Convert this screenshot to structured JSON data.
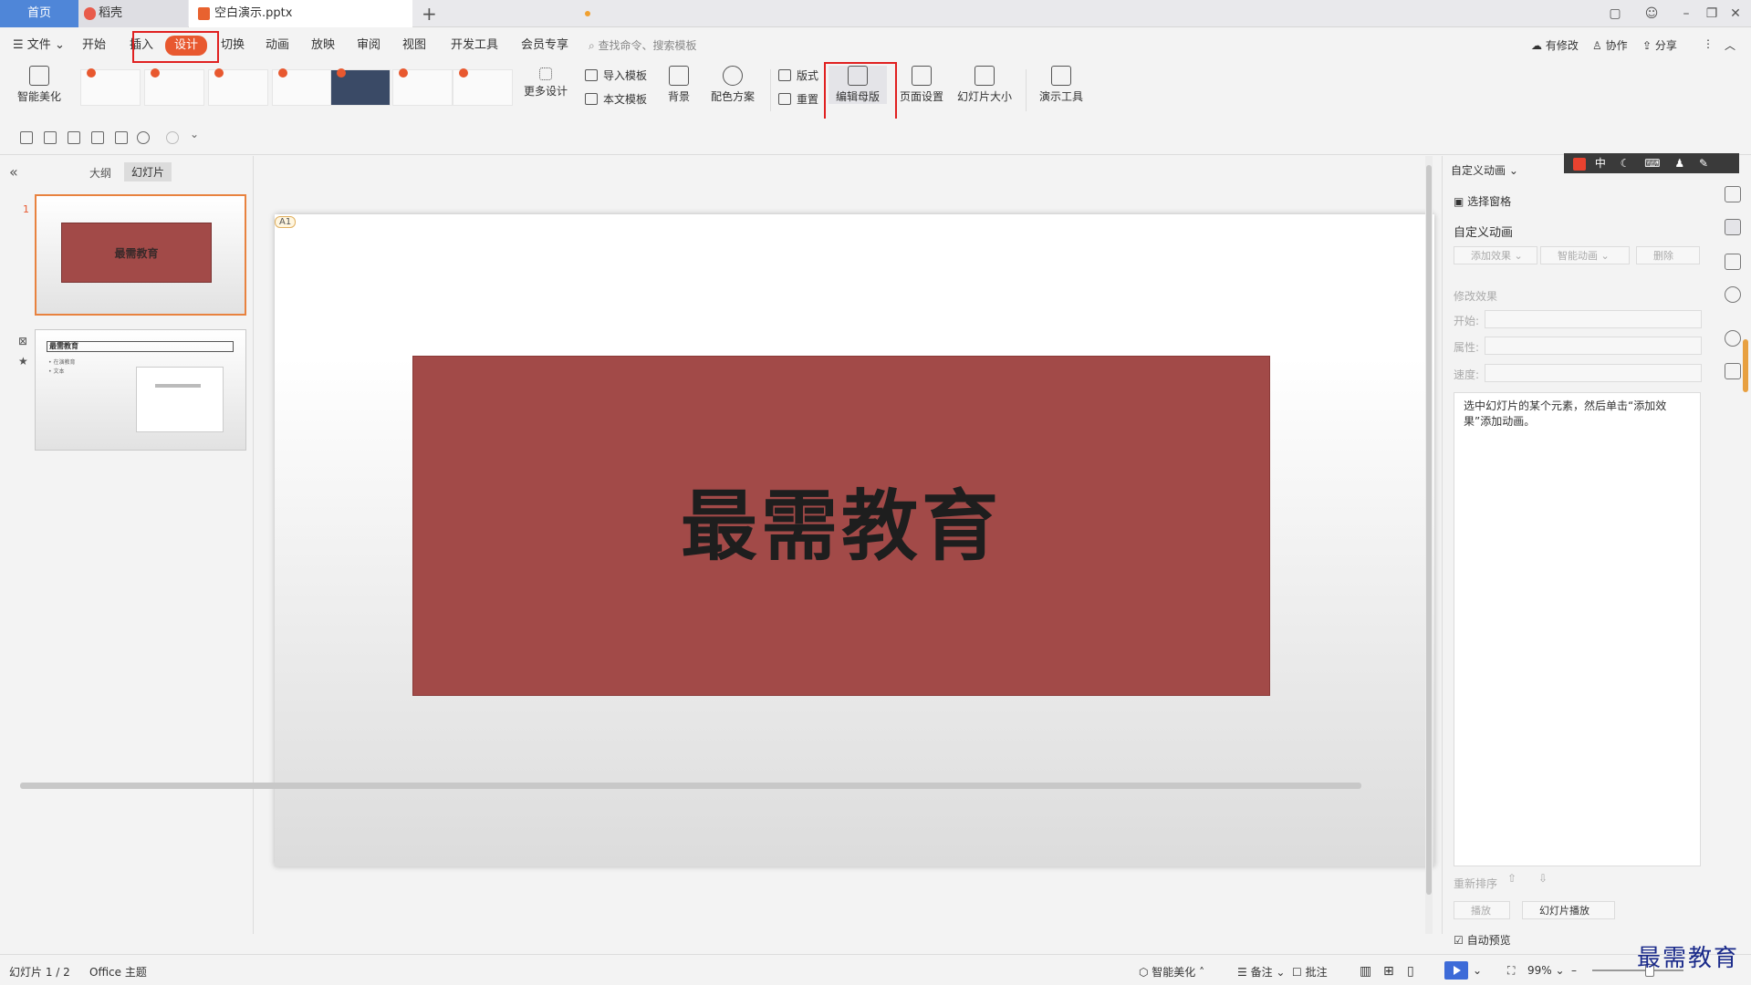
{
  "tabs": {
    "home": "首页",
    "docer": "稻壳",
    "file": "空白演示.pptx",
    "new_tab": "+"
  },
  "menu": {
    "file": "文件",
    "items": [
      "开始",
      "插入",
      "设计",
      "切换",
      "动画",
      "放映",
      "审阅",
      "视图",
      "开发工具",
      "会员专享"
    ],
    "search_placeholder": "查找命令、搜索模板",
    "right": [
      "有修改",
      "协作",
      "分享"
    ]
  },
  "ribbon": {
    "smart_beautify": "智能美化",
    "more_design": "更多设计",
    "import_template": "导入模板",
    "text_template": "本文模板",
    "background": "背景",
    "color_scheme": "配色方案",
    "layout": "版式",
    "reset": "重置",
    "edit_master": "编辑母版",
    "page_setup": "页面设置",
    "slide_size": "幻灯片大小",
    "presentation_tools": "演示工具"
  },
  "left_panel": {
    "outline": "大纲",
    "slides": "幻灯片",
    "slide1_num": "1",
    "slide1_text": "最需教育",
    "slide2_title": "最需教育",
    "slide2_bullets": [
      "• 在演教育",
      "• 文本"
    ]
  },
  "canvas": {
    "tag": "A1",
    "title": "最需教育"
  },
  "right_panel": {
    "header": "自定义动画",
    "selection_pane": "选择窗格",
    "section": "自定义动画",
    "add_effect": "添加效果",
    "smart_anim": "智能动画",
    "delete": "删除",
    "modify": "修改效果",
    "start": "开始:",
    "property": "属性:",
    "speed": "速度:",
    "info": "选中幻灯片的某个元素，然后单击“添加效果”添加动画。",
    "reorder": "重新排序",
    "play": "播放",
    "slideshow": "幻灯片播放",
    "auto_preview": "自动预览"
  },
  "ime": "中",
  "status": {
    "slide_count": "幻灯片 1 / 2",
    "theme": "Office 主题",
    "smart_beautify": "智能美化",
    "notes": "备注",
    "comments": "批注",
    "zoom": "99%"
  },
  "watermark": "最需教育",
  "colors": {
    "accent": "#e8582f",
    "highlight_box": "#e02020",
    "slide_box": "#a24a48",
    "home_tab": "#4f86d8"
  }
}
